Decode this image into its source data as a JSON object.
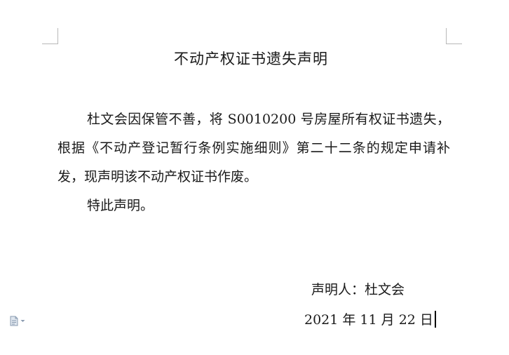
{
  "document": {
    "title": "不动产权证书遗失声明",
    "paragraphs": [
      "杜文会因保管不善，将 S0010200 号房屋所有权证书遗失，根据《不动产登记暂行条例实施细则》第二十二条的规定申请补发，现声明该不动产权证书作废。",
      "特此声明。"
    ],
    "signature": "声明人：杜文会",
    "date": "2021 年 11 月 22 日"
  },
  "icons": {
    "paste_options": "paste-options-icon",
    "dropdown": "chevron-down-icon"
  },
  "colors": {
    "text": "#1a1a1a",
    "corner_marks": "#b8b8b8",
    "icon": "#8a9bb0"
  }
}
